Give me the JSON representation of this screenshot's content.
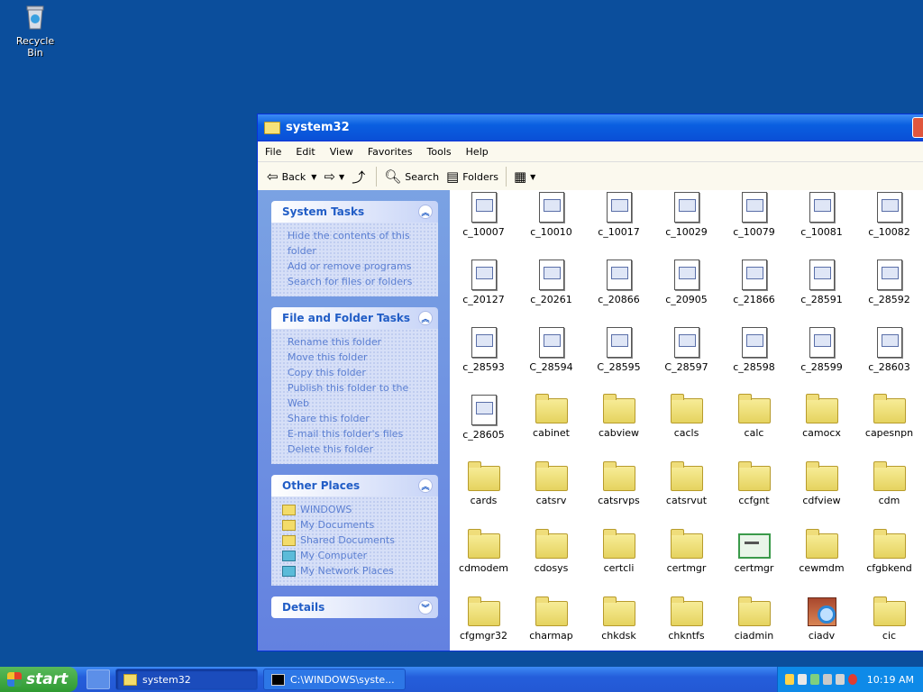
{
  "desktop": {
    "recycle_bin_label": "Recycle Bin"
  },
  "window": {
    "title": "system32",
    "menu": [
      "File",
      "Edit",
      "View",
      "Favorites",
      "Tools",
      "Help"
    ],
    "toolbar": {
      "back_label": "Back",
      "search_label": "Search",
      "folders_label": "Folders"
    }
  },
  "tasks": {
    "system": {
      "title": "System Tasks",
      "items": [
        "Hide the contents of this folder",
        "Add or remove programs",
        "Search for files or folders"
      ]
    },
    "file_folder": {
      "title": "File and Folder Tasks",
      "items": [
        "Rename this folder",
        "Move this folder",
        "Copy this folder",
        "Publish this folder to the Web",
        "Share this folder",
        "E-mail this folder's files",
        "Delete this folder"
      ]
    },
    "other_places": {
      "title": "Other Places",
      "items": [
        "WINDOWS",
        "My Documents",
        "Shared Documents",
        "My Computer",
        "My Network Places"
      ]
    },
    "details": {
      "title": "Details"
    }
  },
  "files": [
    {
      "name": "c_10007",
      "type": "exe"
    },
    {
      "name": "c_10010",
      "type": "exe"
    },
    {
      "name": "c_10017",
      "type": "exe"
    },
    {
      "name": "c_10029",
      "type": "exe"
    },
    {
      "name": "c_10079",
      "type": "exe"
    },
    {
      "name": "c_10081",
      "type": "exe"
    },
    {
      "name": "c_10082",
      "type": "exe"
    },
    {
      "name": "c_20127",
      "type": "exe"
    },
    {
      "name": "c_20261",
      "type": "exe"
    },
    {
      "name": "c_20866",
      "type": "exe"
    },
    {
      "name": "c_20905",
      "type": "exe"
    },
    {
      "name": "c_21866",
      "type": "exe"
    },
    {
      "name": "c_28591",
      "type": "exe"
    },
    {
      "name": "c_28592",
      "type": "exe"
    },
    {
      "name": "c_28593",
      "type": "exe"
    },
    {
      "name": "C_28594",
      "type": "exe"
    },
    {
      "name": "C_28595",
      "type": "exe"
    },
    {
      "name": "C_28597",
      "type": "exe"
    },
    {
      "name": "c_28598",
      "type": "exe"
    },
    {
      "name": "c_28599",
      "type": "exe"
    },
    {
      "name": "c_28603",
      "type": "exe"
    },
    {
      "name": "c_28605",
      "type": "exe"
    },
    {
      "name": "cabinet",
      "type": "folder"
    },
    {
      "name": "cabview",
      "type": "folder"
    },
    {
      "name": "cacls",
      "type": "folder"
    },
    {
      "name": "calc",
      "type": "folder"
    },
    {
      "name": "camocx",
      "type": "folder"
    },
    {
      "name": "capesnpn",
      "type": "folder"
    },
    {
      "name": "cards",
      "type": "folder"
    },
    {
      "name": "catsrv",
      "type": "folder"
    },
    {
      "name": "catsrvps",
      "type": "folder"
    },
    {
      "name": "catsrvut",
      "type": "folder"
    },
    {
      "name": "ccfgnt",
      "type": "folder"
    },
    {
      "name": "cdfview",
      "type": "folder"
    },
    {
      "name": "cdm",
      "type": "folder"
    },
    {
      "name": "cdmodem",
      "type": "folder"
    },
    {
      "name": "cdosys",
      "type": "folder"
    },
    {
      "name": "certcli",
      "type": "folder"
    },
    {
      "name": "certmgr",
      "type": "folder"
    },
    {
      "name": "certmgr",
      "type": "cert"
    },
    {
      "name": "cewmdm",
      "type": "folder"
    },
    {
      "name": "cfgbkend",
      "type": "folder"
    },
    {
      "name": "cfgmgr32",
      "type": "folder"
    },
    {
      "name": "charmap",
      "type": "folder"
    },
    {
      "name": "chkdsk",
      "type": "folder"
    },
    {
      "name": "chkntfs",
      "type": "folder"
    },
    {
      "name": "ciadmin",
      "type": "folder"
    },
    {
      "name": "ciadv",
      "type": "ciadv"
    },
    {
      "name": "cic",
      "type": "folder"
    }
  ],
  "taskbar": {
    "start_label": "start",
    "tasks": [
      "system32",
      "C:\\WINDOWS\\syste..."
    ],
    "clock": "10:19 AM"
  }
}
